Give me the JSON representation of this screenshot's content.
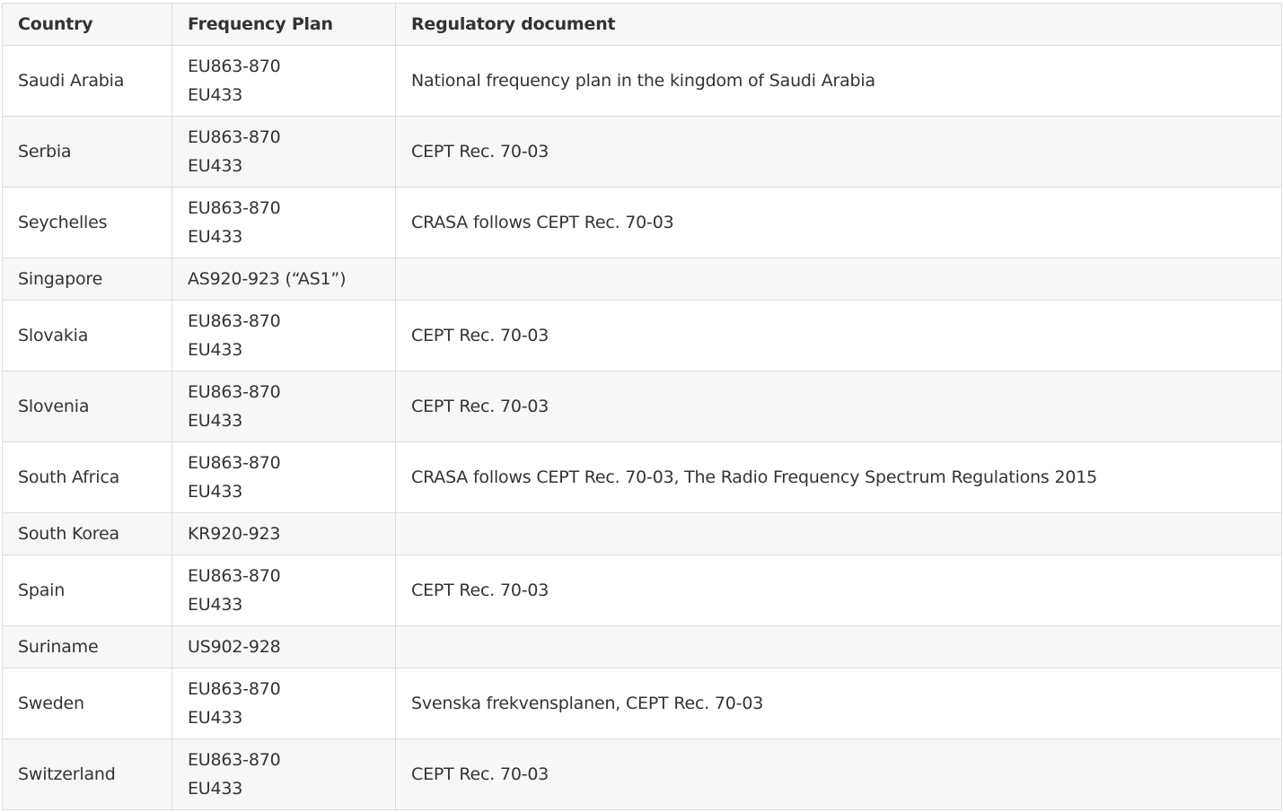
{
  "table": {
    "headers": [
      "Country",
      "Frequency Plan",
      "Regulatory document"
    ],
    "rows": [
      {
        "country": "Saudi Arabia",
        "plans": [
          "EU863-870",
          "EU433"
        ],
        "document": "National frequency plan in the kingdom of Saudi Arabia"
      },
      {
        "country": "Serbia",
        "plans": [
          "EU863-870",
          "EU433"
        ],
        "document": "CEPT Rec. 70-03"
      },
      {
        "country": "Seychelles",
        "plans": [
          "EU863-870",
          "EU433"
        ],
        "document": "CRASA follows CEPT Rec. 70-03"
      },
      {
        "country": "Singapore",
        "plans": [
          "AS920-923 (“AS1”)"
        ],
        "document": ""
      },
      {
        "country": "Slovakia",
        "plans": [
          "EU863-870",
          "EU433"
        ],
        "document": "CEPT Rec. 70-03"
      },
      {
        "country": "Slovenia",
        "plans": [
          "EU863-870",
          "EU433"
        ],
        "document": "CEPT Rec. 70-03"
      },
      {
        "country": "South Africa",
        "plans": [
          "EU863-870",
          "EU433"
        ],
        "document": "CRASA follows CEPT Rec. 70-03, The Radio Frequency Spectrum Regulations 2015"
      },
      {
        "country": "South Korea",
        "plans": [
          "KR920-923"
        ],
        "document": ""
      },
      {
        "country": "Spain",
        "plans": [
          "EU863-870",
          "EU433"
        ],
        "document": "CEPT Rec. 70-03"
      },
      {
        "country": "Suriname",
        "plans": [
          "US902-928"
        ],
        "document": ""
      },
      {
        "country": "Sweden",
        "plans": [
          "EU863-870",
          "EU433"
        ],
        "document": "Svenska frekvensplanen, CEPT Rec. 70-03"
      },
      {
        "country": "Switzerland",
        "plans": [
          "EU863-870",
          "EU433"
        ],
        "document": "CEPT Rec. 70-03"
      }
    ]
  }
}
